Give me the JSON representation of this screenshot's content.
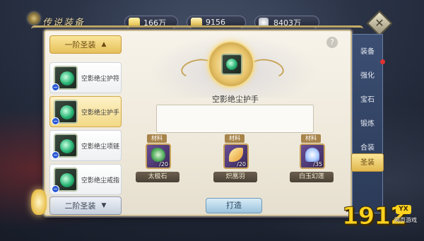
{
  "window": {
    "title": "传说装备"
  },
  "resources": [
    {
      "icon": "gold-coin-icon",
      "value": "166万"
    },
    {
      "icon": "ingot-icon",
      "value": "9156"
    },
    {
      "icon": "silver-coin-icon",
      "value": "8403万"
    }
  ],
  "equipment_list": {
    "group1": {
      "label": "一阶圣装",
      "chevron": "▲"
    },
    "items": [
      {
        "label": "空影绝尘护符",
        "badge": "−"
      },
      {
        "label": "空影绝尘护手",
        "badge": "−"
      },
      {
        "label": "空影绝尘项链",
        "badge": "−"
      },
      {
        "label": "空影绝尘戒指",
        "badge": "−"
      }
    ],
    "group2": {
      "label": "二阶圣装",
      "chevron": "▼"
    },
    "selected_index": 1
  },
  "detail": {
    "help": "?",
    "equip_name": "空影绝尘护手",
    "materials": [
      {
        "tag": "材料",
        "name": "太极石",
        "count": "/20"
      },
      {
        "tag": "材料",
        "name": "炽凰羽",
        "count": "/20"
      },
      {
        "tag": "材料",
        "name": "白玉幻莲",
        "count": "/35"
      }
    ],
    "craft_button": "打造"
  },
  "tabs": [
    {
      "label": "装备"
    },
    {
      "label": "强化"
    },
    {
      "label": "宝石"
    },
    {
      "label": "锻炼"
    },
    {
      "label": "合装"
    },
    {
      "label": "圣装"
    }
  ],
  "selected_tab": "圣装",
  "watermark": {
    "number": "1912",
    "badge": "YX",
    "sub": "网页游戏"
  },
  "colors": {
    "accent_gold": "#e5c05b",
    "tab_bg": "#2b3a58",
    "panel_bg": "#f7f3ea",
    "alert": "#e23232"
  }
}
